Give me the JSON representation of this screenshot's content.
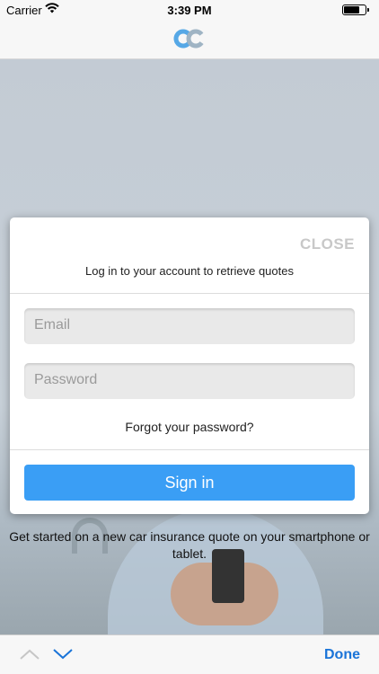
{
  "status_bar": {
    "carrier": "Carrier",
    "time": "3:39 PM"
  },
  "nav": {
    "logo_icon": "cc-logo-icon"
  },
  "modal": {
    "close_label": "CLOSE",
    "title": "Log in to your account to retrieve quotes",
    "email": {
      "placeholder": "Email",
      "value": ""
    },
    "password": {
      "placeholder": "Password",
      "value": ""
    },
    "forgot_label": "Forgot your password?",
    "signin_label": "Sign in"
  },
  "promo": {
    "text": "Get started on a new car insurance quote on your smartphone or tablet."
  },
  "toolbar": {
    "done_label": "Done",
    "prev_icon": "chevron-up-icon",
    "next_icon": "chevron-down-icon"
  },
  "colors": {
    "accent": "#3a9ef5",
    "link": "#1a74d8",
    "close": "#c8c8c8"
  }
}
